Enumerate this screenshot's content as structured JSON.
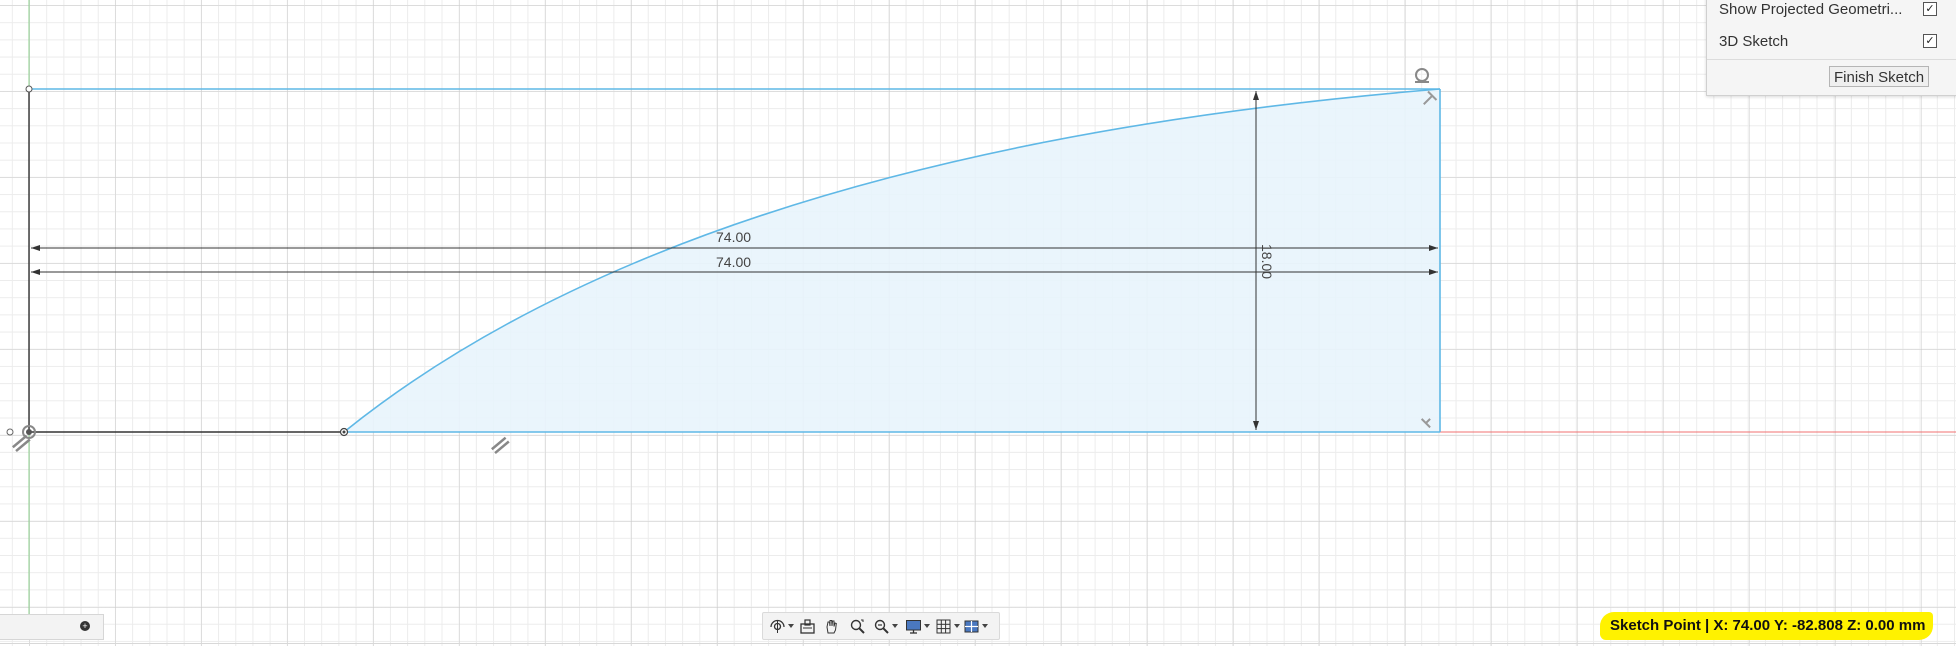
{
  "palette": {
    "options": [
      {
        "label": "Show Projected Geometri...",
        "checked": true
      },
      {
        "label": "3D Sketch",
        "checked": true
      }
    ],
    "finish_label": "Finish Sketch"
  },
  "dimensions": {
    "width_upper": "74.00",
    "width_lower": "74.00",
    "height": "18.00"
  },
  "status_bar": {
    "text": "Sketch Point | X: 74.00 Y: -82.808 Z: 0.00 mm"
  },
  "nav_toolbar": {
    "tools": [
      "orbit-icon",
      "look-at-icon",
      "pan-icon",
      "zoom-icon",
      "fit-icon",
      "display-settings-icon",
      "grid-settings-icon",
      "viewports-icon"
    ]
  },
  "colors": {
    "sketch_line": "#5fb8e6",
    "profile_fill": "#e8f4fc",
    "x_axis": "#f07070",
    "y_axis": "#8ed08e",
    "status_highlight": "#fff200"
  }
}
